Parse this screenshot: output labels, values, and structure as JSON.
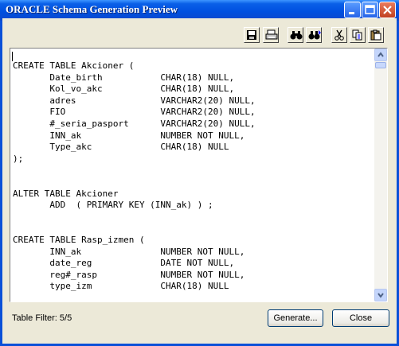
{
  "window": {
    "title": "ORACLE Schema Generation Preview"
  },
  "titlebar_buttons": [
    {
      "name": "minimize-button",
      "icon": "minimize-icon"
    },
    {
      "name": "maximize-button",
      "icon": "maximize-icon"
    },
    {
      "name": "close-window-button",
      "icon": "close-icon"
    }
  ],
  "toolbar": [
    {
      "name": "save-button",
      "icon": "save-icon"
    },
    {
      "name": "print-button",
      "icon": "print-icon"
    },
    {
      "name": "find-button",
      "icon": "binoculars-icon"
    },
    {
      "name": "find-next-button",
      "icon": "find-next-icon"
    },
    {
      "name": "cut-button",
      "icon": "scissors-icon"
    },
    {
      "name": "copy-button",
      "icon": "copy-icon"
    },
    {
      "name": "paste-button",
      "icon": "paste-icon"
    }
  ],
  "editor": {
    "lines": [
      "CREATE TABLE Akcioner (",
      "       Date_birth           CHAR(18) NULL,",
      "       Kol_vo_akc           CHAR(18) NULL,",
      "       adres                VARCHAR2(20) NULL,",
      "       FIO                  VARCHAR2(20) NULL,",
      "       #_seria_pasport      VARCHAR2(20) NULL,",
      "       INN_ak               NUMBER NOT NULL,",
      "       Type_akc             CHAR(18) NULL",
      ");",
      "",
      "",
      "ALTER TABLE Akcioner",
      "       ADD  ( PRIMARY KEY (INN_ak) ) ;",
      "",
      "",
      "CREATE TABLE Rasp_izmen (",
      "       INN_ak               NUMBER NOT NULL,",
      "       date_reg             DATE NOT NULL,",
      "       reg#_rasp            NUMBER NOT NULL,",
      "       type_izm             CHAR(18) NULL"
    ]
  },
  "footer": {
    "table_filter": "Table Filter: 5/5",
    "generate_label": "Generate...",
    "close_label": "Close"
  }
}
